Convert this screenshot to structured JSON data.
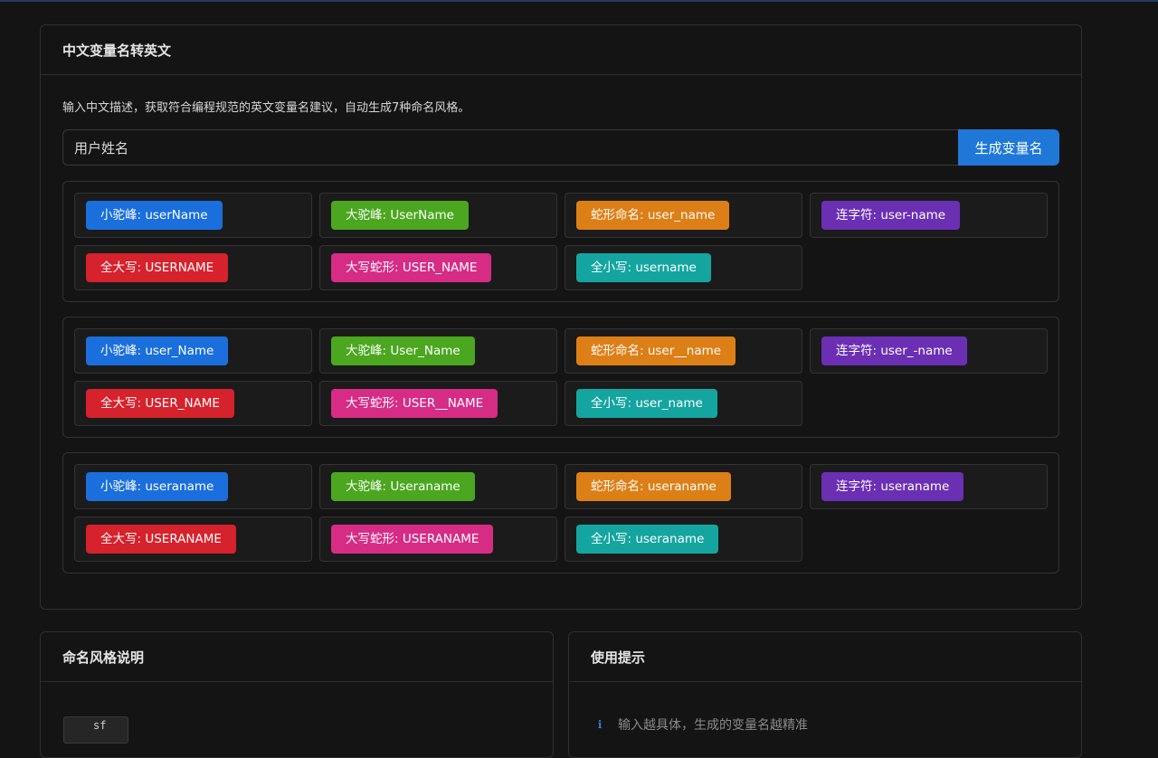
{
  "main_card": {
    "title": "中文变量名转英文",
    "description": "输入中文描述，获取符合编程规范的英文变量名建议，自动生成7种命名风格。",
    "input_value": "用户姓名",
    "generate_button": "生成变量名"
  },
  "styles": [
    {
      "key": "camel",
      "label": "小驼峰",
      "color": "#1a6fdc"
    },
    {
      "key": "pascal",
      "label": "大驼峰",
      "color": "#4aa71f"
    },
    {
      "key": "snake",
      "label": "蛇形命名",
      "color": "#dd7f17"
    },
    {
      "key": "kebab",
      "label": "连字符",
      "color": "#6b2fb4"
    },
    {
      "key": "upper",
      "label": "全大写",
      "color": "#d6222c"
    },
    {
      "key": "upper_snake",
      "label": "大写蛇形",
      "color": "#d62c86"
    },
    {
      "key": "lower",
      "label": "全小写",
      "color": "#15a5a0"
    }
  ],
  "results": [
    {
      "camel": "小驼峰: userName",
      "pascal": "大驼峰: UserName",
      "snake": "蛇形命名: user_name",
      "kebab": "连字符: user-name",
      "upper": "全大写: USERNAME",
      "upper_snake": "大写蛇形: USER_NAME",
      "lower": "全小写: username"
    },
    {
      "camel": "小驼峰: user_Name",
      "pascal": "大驼峰: User_Name",
      "snake": "蛇形命名: user__name",
      "kebab": "连字符: user_-name",
      "upper": "全大写: USER_NAME",
      "upper_snake": "大写蛇形: USER__NAME",
      "lower": "全小写: user_name"
    },
    {
      "camel": "小驼峰: useraname",
      "pascal": "大驼峰: Useraname",
      "snake": "蛇形命名: useraname",
      "kebab": "连字符: useraname",
      "upper": "全大写: USERANAME",
      "upper_snake": "大写蛇形: USERANAME",
      "lower": "全小写: useraname"
    }
  ],
  "naming_card": {
    "title": "命名风格说明",
    "first_item_tag": "sf"
  },
  "tips_card": {
    "title": "使用提示",
    "tip_icon": "info-icon",
    "first_tip": "输入越具体，生成的变量名越精准"
  }
}
